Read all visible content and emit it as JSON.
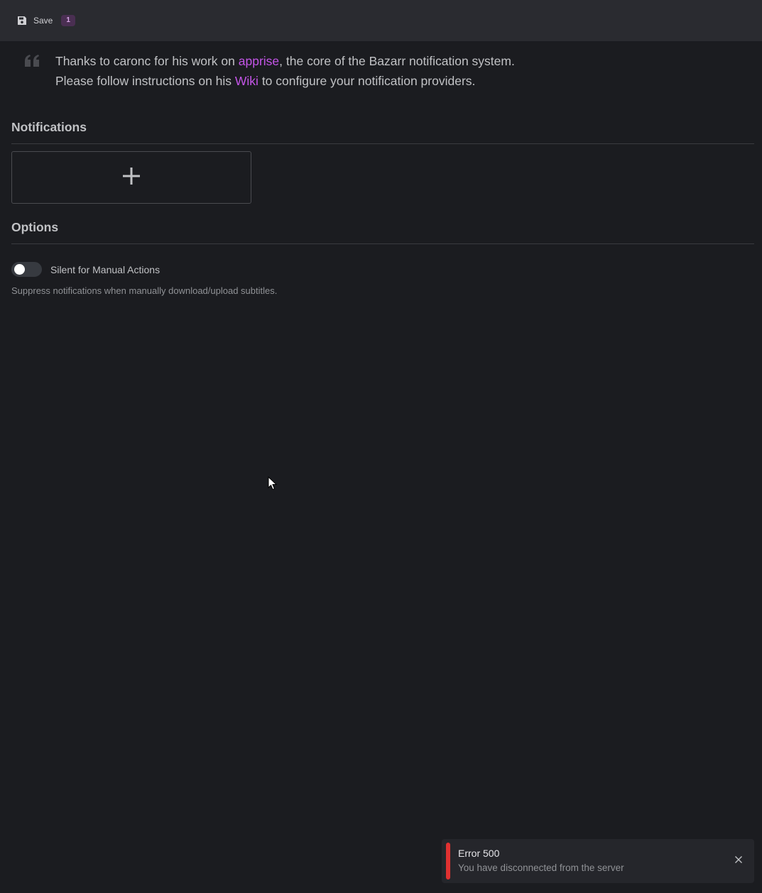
{
  "toolbar": {
    "save_label": "Save",
    "save_badge": "1",
    "save_icon": "floppy-disk-icon"
  },
  "intro": {
    "line1_before": "Thanks to caronc for his work on ",
    "line1_link": "apprise",
    "line1_after": ", the core of the Bazarr notification system.",
    "line2_before": "Please follow instructions on his ",
    "line2_link": "Wiki",
    "line2_after": " to configure your notification providers.",
    "quote_icon": "quote-icon"
  },
  "notifications": {
    "title": "Notifications",
    "add_icon": "plus-icon"
  },
  "options": {
    "title": "Options",
    "silent_toggle": {
      "label": "Silent for Manual Actions",
      "description": "Suppress notifications when manually download/upload subtitles.",
      "checked": false
    }
  },
  "toast": {
    "title": "Error 500",
    "message": "You have disconnected from the server",
    "close_icon": "close-icon",
    "accent": "#e03131"
  },
  "colors": {
    "link": "#c455e8",
    "background": "#1b1c20",
    "toolbar": "#2a2b30"
  }
}
